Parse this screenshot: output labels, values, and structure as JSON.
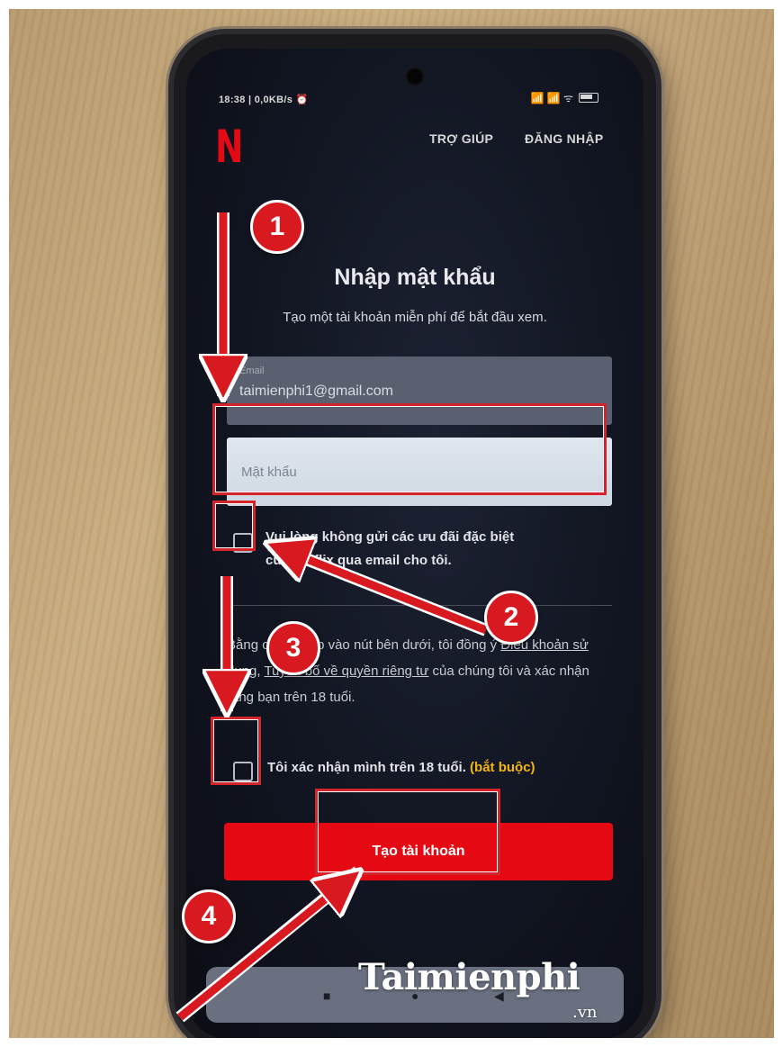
{
  "status_bar": {
    "time": "18:38 | 0,0KB/s ⏰",
    "icons": "📶 📶 ᯤ"
  },
  "header": {
    "logo": "N",
    "help": "TRỢ GIÚP",
    "login": "ĐĂNG NHẬP"
  },
  "form": {
    "title": "Nhập mật khẩu",
    "subtitle": "Tạo một tài khoản miễn phí để bắt đầu xem.",
    "email_label": "Email",
    "email_value": "taimienphi1@gmail.com",
    "password_placeholder": "Mật khẩu",
    "no_offers_line1": "Vui lòng không gửi các ưu đãi đặc biệt",
    "no_offers_line2": "của Netflix qua email cho tôi.",
    "legal_line1": "Bằng cách nhấp vào nút bên dưới, tôi đồng ý",
    "legal_terms": "Điều khoản sử dụng",
    "legal_sep": ", ",
    "legal_privacy": "Tuyên bố về quyền riêng tư",
    "legal_rest": " của chúng tôi và xác nhận rằng bạn trên 18 tuổi.",
    "age_confirm": "Tôi xác nhận mình trên 18 tuổi.",
    "required": "(bắt buộc)",
    "create_button": "Tạo tài khoản"
  },
  "nav_bar": {
    "stop": "■",
    "home": "●",
    "back": "◀"
  },
  "annotations": {
    "step1": "1",
    "step2": "2",
    "step3": "3",
    "step4": "4",
    "accent": "#d8191f"
  },
  "watermark": {
    "brand": "Taimienphi",
    "domain": ".vn"
  }
}
